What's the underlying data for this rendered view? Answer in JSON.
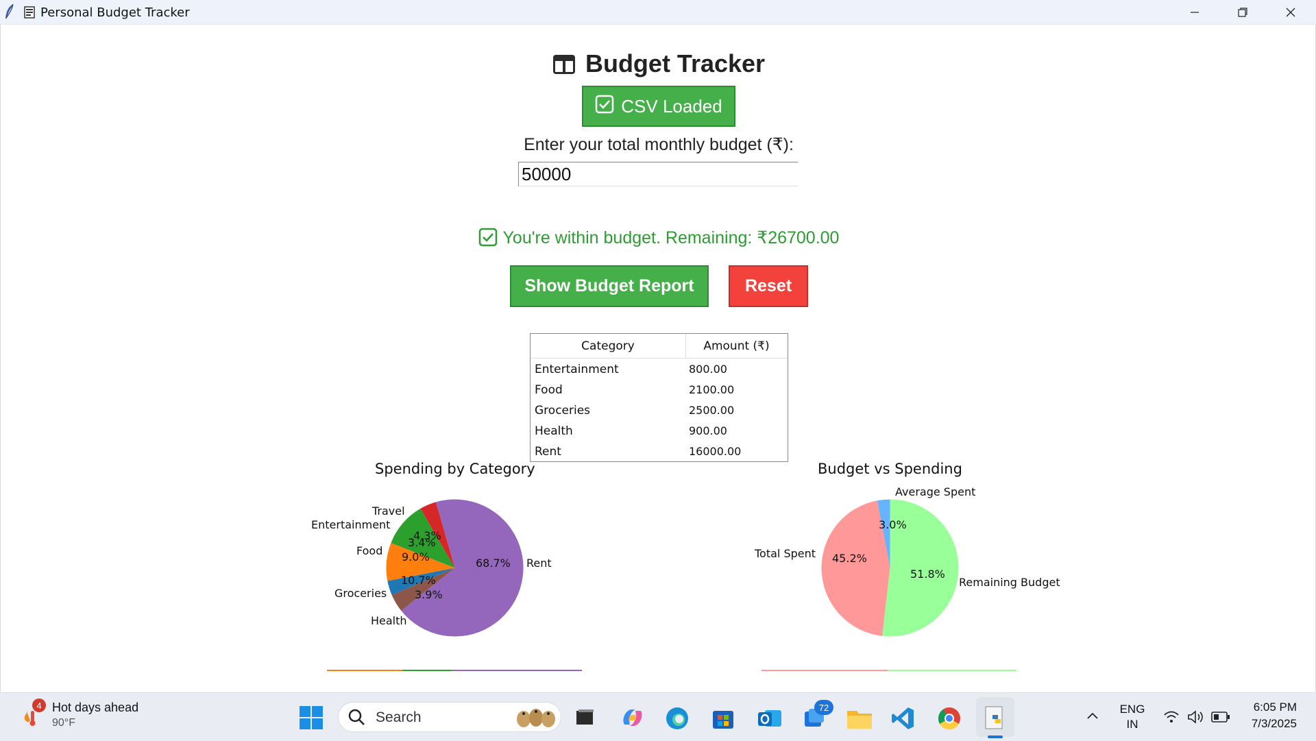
{
  "window": {
    "title": "Personal Budget Tracker"
  },
  "app": {
    "heading": "Budget Tracker",
    "csv_button_label": "CSV Loaded",
    "budget_prompt": "Enter your total monthly budget (₹):",
    "budget_value": "50000",
    "status_message": "You're within budget. Remaining: ₹26700.00",
    "status_color": "#2e9b34",
    "report_button_label": "Show Budget Report",
    "reset_button_label": "Reset"
  },
  "table": {
    "headers": [
      "Category",
      "Amount (₹)"
    ],
    "rows": [
      {
        "category": "Entertainment",
        "amount": "800.00"
      },
      {
        "category": "Food",
        "amount": "2100.00"
      },
      {
        "category": "Groceries",
        "amount": "2500.00"
      },
      {
        "category": "Health",
        "amount": "900.00"
      },
      {
        "category": "Rent",
        "amount": "16000.00"
      }
    ]
  },
  "chart_data": [
    {
      "type": "pie",
      "title": "Spending by Category",
      "slices": [
        {
          "label": "Rent",
          "value": 68.7,
          "pct_label": "68.7%",
          "color": "#9467bd"
        },
        {
          "label": "Travel",
          "value": 4.3,
          "pct_label": "4.3%",
          "color": "#8c564b"
        },
        {
          "label": "Entertainment",
          "value": 3.4,
          "pct_label": "3.4%",
          "color": "#1f77b4"
        },
        {
          "label": "Food",
          "value": 9.0,
          "pct_label": "9.0%",
          "color": "#ff7f0e"
        },
        {
          "label": "Groceries",
          "value": 10.7,
          "pct_label": "10.7%",
          "color": "#2ca02c"
        },
        {
          "label": "Health",
          "value": 3.9,
          "pct_label": "3.9%",
          "color": "#d62728"
        }
      ]
    },
    {
      "type": "pie",
      "title": "Budget vs Spending",
      "slices": [
        {
          "label": "Average Spent",
          "value": 3.0,
          "pct_label": "3.0%",
          "color": "#66b3ff"
        },
        {
          "label": "Total Spent",
          "value": 45.2,
          "pct_label": "45.2%",
          "color": "#ff9999"
        },
        {
          "label": "Remaining Budget",
          "value": 51.8,
          "pct_label": "51.8%",
          "color": "#99ff99"
        }
      ]
    }
  ],
  "taskbar": {
    "weather_title": "Hot days ahead",
    "weather_temp": "90°F",
    "weather_badge": "4",
    "search_placeholder": "Search",
    "outlook_badge": "72",
    "lang_line1": "ENG",
    "lang_line2": "IN",
    "time": "6:05 PM",
    "date": "7/3/2025"
  }
}
